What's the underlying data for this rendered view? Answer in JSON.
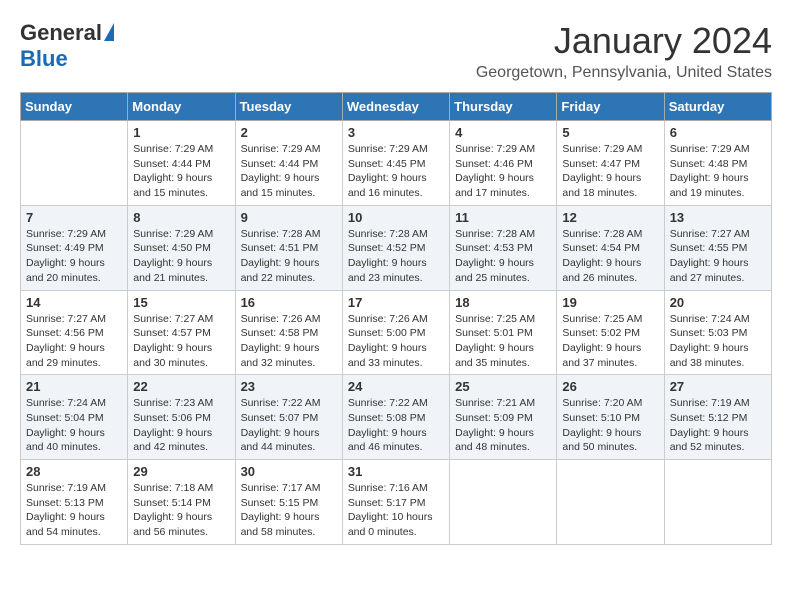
{
  "header": {
    "logo_general": "General",
    "logo_blue": "Blue",
    "month_title": "January 2024",
    "location": "Georgetown, Pennsylvania, United States"
  },
  "days_of_week": [
    "Sunday",
    "Monday",
    "Tuesday",
    "Wednesday",
    "Thursday",
    "Friday",
    "Saturday"
  ],
  "weeks": [
    [
      {
        "day": "",
        "info": ""
      },
      {
        "day": "1",
        "info": "Sunrise: 7:29 AM\nSunset: 4:44 PM\nDaylight: 9 hours\nand 15 minutes."
      },
      {
        "day": "2",
        "info": "Sunrise: 7:29 AM\nSunset: 4:44 PM\nDaylight: 9 hours\nand 15 minutes."
      },
      {
        "day": "3",
        "info": "Sunrise: 7:29 AM\nSunset: 4:45 PM\nDaylight: 9 hours\nand 16 minutes."
      },
      {
        "day": "4",
        "info": "Sunrise: 7:29 AM\nSunset: 4:46 PM\nDaylight: 9 hours\nand 17 minutes."
      },
      {
        "day": "5",
        "info": "Sunrise: 7:29 AM\nSunset: 4:47 PM\nDaylight: 9 hours\nand 18 minutes."
      },
      {
        "day": "6",
        "info": "Sunrise: 7:29 AM\nSunset: 4:48 PM\nDaylight: 9 hours\nand 19 minutes."
      }
    ],
    [
      {
        "day": "7",
        "info": "Sunrise: 7:29 AM\nSunset: 4:49 PM\nDaylight: 9 hours\nand 20 minutes."
      },
      {
        "day": "8",
        "info": "Sunrise: 7:29 AM\nSunset: 4:50 PM\nDaylight: 9 hours\nand 21 minutes."
      },
      {
        "day": "9",
        "info": "Sunrise: 7:28 AM\nSunset: 4:51 PM\nDaylight: 9 hours\nand 22 minutes."
      },
      {
        "day": "10",
        "info": "Sunrise: 7:28 AM\nSunset: 4:52 PM\nDaylight: 9 hours\nand 23 minutes."
      },
      {
        "day": "11",
        "info": "Sunrise: 7:28 AM\nSunset: 4:53 PM\nDaylight: 9 hours\nand 25 minutes."
      },
      {
        "day": "12",
        "info": "Sunrise: 7:28 AM\nSunset: 4:54 PM\nDaylight: 9 hours\nand 26 minutes."
      },
      {
        "day": "13",
        "info": "Sunrise: 7:27 AM\nSunset: 4:55 PM\nDaylight: 9 hours\nand 27 minutes."
      }
    ],
    [
      {
        "day": "14",
        "info": "Sunrise: 7:27 AM\nSunset: 4:56 PM\nDaylight: 9 hours\nand 29 minutes."
      },
      {
        "day": "15",
        "info": "Sunrise: 7:27 AM\nSunset: 4:57 PM\nDaylight: 9 hours\nand 30 minutes."
      },
      {
        "day": "16",
        "info": "Sunrise: 7:26 AM\nSunset: 4:58 PM\nDaylight: 9 hours\nand 32 minutes."
      },
      {
        "day": "17",
        "info": "Sunrise: 7:26 AM\nSunset: 5:00 PM\nDaylight: 9 hours\nand 33 minutes."
      },
      {
        "day": "18",
        "info": "Sunrise: 7:25 AM\nSunset: 5:01 PM\nDaylight: 9 hours\nand 35 minutes."
      },
      {
        "day": "19",
        "info": "Sunrise: 7:25 AM\nSunset: 5:02 PM\nDaylight: 9 hours\nand 37 minutes."
      },
      {
        "day": "20",
        "info": "Sunrise: 7:24 AM\nSunset: 5:03 PM\nDaylight: 9 hours\nand 38 minutes."
      }
    ],
    [
      {
        "day": "21",
        "info": "Sunrise: 7:24 AM\nSunset: 5:04 PM\nDaylight: 9 hours\nand 40 minutes."
      },
      {
        "day": "22",
        "info": "Sunrise: 7:23 AM\nSunset: 5:06 PM\nDaylight: 9 hours\nand 42 minutes."
      },
      {
        "day": "23",
        "info": "Sunrise: 7:22 AM\nSunset: 5:07 PM\nDaylight: 9 hours\nand 44 minutes."
      },
      {
        "day": "24",
        "info": "Sunrise: 7:22 AM\nSunset: 5:08 PM\nDaylight: 9 hours\nand 46 minutes."
      },
      {
        "day": "25",
        "info": "Sunrise: 7:21 AM\nSunset: 5:09 PM\nDaylight: 9 hours\nand 48 minutes."
      },
      {
        "day": "26",
        "info": "Sunrise: 7:20 AM\nSunset: 5:10 PM\nDaylight: 9 hours\nand 50 minutes."
      },
      {
        "day": "27",
        "info": "Sunrise: 7:19 AM\nSunset: 5:12 PM\nDaylight: 9 hours\nand 52 minutes."
      }
    ],
    [
      {
        "day": "28",
        "info": "Sunrise: 7:19 AM\nSunset: 5:13 PM\nDaylight: 9 hours\nand 54 minutes."
      },
      {
        "day": "29",
        "info": "Sunrise: 7:18 AM\nSunset: 5:14 PM\nDaylight: 9 hours\nand 56 minutes."
      },
      {
        "day": "30",
        "info": "Sunrise: 7:17 AM\nSunset: 5:15 PM\nDaylight: 9 hours\nand 58 minutes."
      },
      {
        "day": "31",
        "info": "Sunrise: 7:16 AM\nSunset: 5:17 PM\nDaylight: 10 hours\nand 0 minutes."
      },
      {
        "day": "",
        "info": ""
      },
      {
        "day": "",
        "info": ""
      },
      {
        "day": "",
        "info": ""
      }
    ]
  ]
}
